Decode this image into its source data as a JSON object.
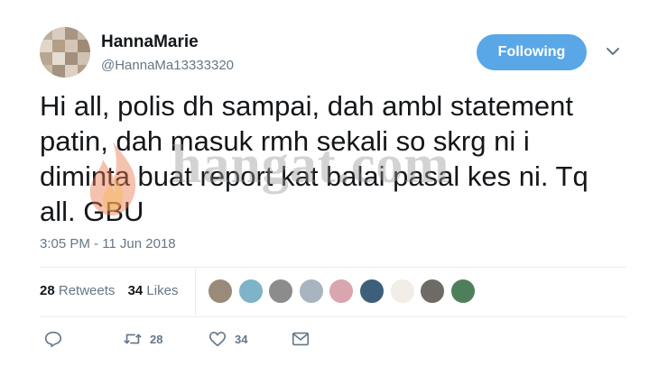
{
  "user": {
    "display_name": "HannaMarie",
    "handle": "@HannaMa13333320",
    "follow_label": "Following"
  },
  "tweet": {
    "text": "Hi all, polis dh sampai, dah ambl statement patin, dah masuk rmh sekali so skrg ni i diminta buat report kat balai pasal kes ni. Tq all. GBU",
    "timestamp": "3:05 PM - 11 Jun 2018"
  },
  "stats": {
    "retweets_count": "28",
    "retweets_label": "Retweets",
    "likes_count": "34",
    "likes_label": "Likes"
  },
  "likers": [
    {
      "name": "liker-avatar-1",
      "color": "#9a8a7a"
    },
    {
      "name": "liker-avatar-2",
      "color": "#7fb3c8"
    },
    {
      "name": "liker-avatar-3",
      "color": "#8c8c8c"
    },
    {
      "name": "liker-avatar-4",
      "color": "#a8b4c0"
    },
    {
      "name": "liker-avatar-5",
      "color": "#d9a6b0"
    },
    {
      "name": "liker-avatar-6",
      "color": "#3d5f7a"
    },
    {
      "name": "liker-avatar-7",
      "color": "#f2ede6"
    },
    {
      "name": "liker-avatar-8",
      "color": "#6e6a66"
    },
    {
      "name": "liker-avatar-9",
      "color": "#4f7f5a"
    }
  ],
  "actions": {
    "reply_icon": "reply-icon",
    "retweet_icon": "retweet-icon",
    "retweet_count": "28",
    "like_icon": "heart-icon",
    "like_count": "34",
    "message_icon": "envelope-icon"
  },
  "watermark": {
    "text": "hangat.com"
  },
  "colors": {
    "follow_button": "#5aa7e8",
    "secondary_text": "#657786",
    "divider": "#e6ecf0"
  }
}
